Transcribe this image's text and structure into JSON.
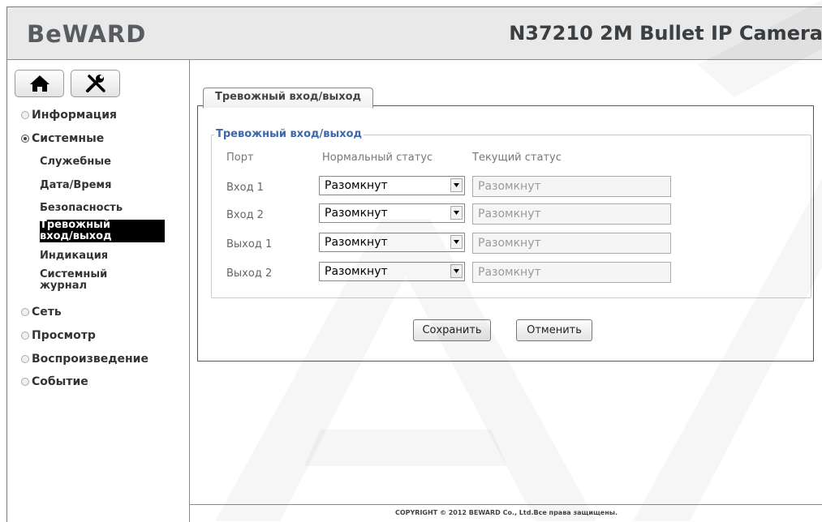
{
  "header": {
    "logo_text": "BeWARD",
    "model_title": "N37210 2M Bullet IP Camera"
  },
  "toolbar": {
    "home_icon": "home-icon",
    "settings_icon": "tools-icon"
  },
  "sidebar": {
    "items": [
      {
        "label": "Информация",
        "state": "collapsed"
      },
      {
        "label": "Системные",
        "state": "expanded"
      },
      {
        "label": "Сеть",
        "state": "collapsed"
      },
      {
        "label": "Просмотр",
        "state": "collapsed"
      },
      {
        "label": "Воспроизведение",
        "state": "collapsed"
      },
      {
        "label": "Событие",
        "state": "collapsed"
      }
    ],
    "sub_items": [
      {
        "label": "Служебные"
      },
      {
        "label": "Дата/Время"
      },
      {
        "label": "Безопасность"
      },
      {
        "label_line1": "Тревожный",
        "label_line2": "вход/выход",
        "active": true
      },
      {
        "label": "Индикация"
      },
      {
        "label_line1": "Системный",
        "label_line2": "журнал"
      }
    ]
  },
  "main": {
    "tab_label": "Тревожный вход/выход",
    "section_title": "Тревожный вход/выход",
    "columns": {
      "port": "Порт",
      "normal_status": "Нормальный статус",
      "current_status": "Текущий статус"
    },
    "rows": [
      {
        "port": "Вход 1",
        "normal_status": "Разомкнут",
        "current_status": "Разомкнут"
      },
      {
        "port": "Вход 2",
        "normal_status": "Разомкнут",
        "current_status": "Разомкнут"
      },
      {
        "port": "Выход 1",
        "normal_status": "Разомкнут",
        "current_status": "Разомкнут"
      },
      {
        "port": "Выход 2",
        "normal_status": "Разомкнут",
        "current_status": "Разомкнут"
      }
    ],
    "save_label": "Сохранить",
    "cancel_label": "Отменить"
  },
  "footer": {
    "copyright": "COPYRIGHT © 2012 BEWARD Co., Ltd.Все права защищены."
  },
  "colors": {
    "header_bg": "#e9e9e9",
    "legend_blue": "#3c67a8",
    "active_bg": "#000000"
  }
}
